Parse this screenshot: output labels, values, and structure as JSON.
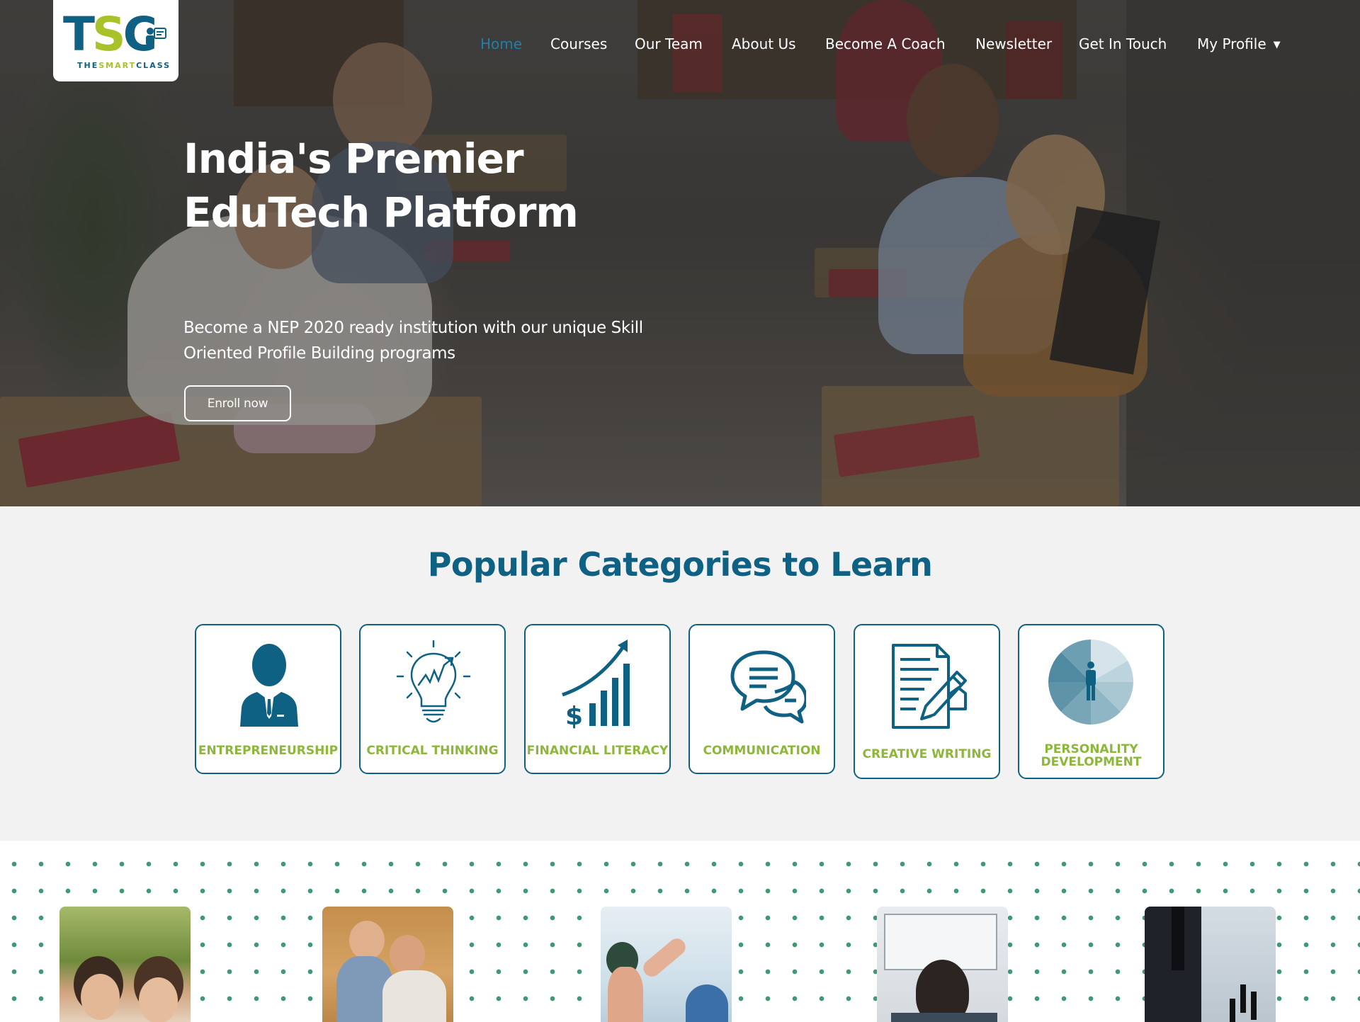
{
  "logo": {
    "letters": [
      "T",
      "S",
      "C"
    ],
    "tagline_parts": [
      "THE",
      "SMART",
      "CLASS"
    ]
  },
  "nav": {
    "items": [
      {
        "label": "Home",
        "active": true
      },
      {
        "label": "Courses"
      },
      {
        "label": "Our Team"
      },
      {
        "label": "About Us"
      },
      {
        "label": "Become A Coach"
      },
      {
        "label": "Newsletter"
      },
      {
        "label": "Get In Touch"
      },
      {
        "label": "My Profile",
        "has_dropdown": true,
        "dropdown_icon": "chevron-down-icon"
      }
    ]
  },
  "hero": {
    "title_line1": "India's Premier",
    "title_line2": "EduTech Platform",
    "subtitle_line1": "Become a NEP 2020 ready institution with our unique Skill",
    "subtitle_line2": "Oriented Profile Building programs",
    "cta_label": "Enroll now"
  },
  "categories": {
    "title": "Popular Categories to Learn",
    "items": [
      {
        "label": "ENTREPRENEURSHIP",
        "icon": "businessman-icon"
      },
      {
        "label": "CRITICAL THINKING",
        "icon": "lightbulb-icon"
      },
      {
        "label": "FINANCIAL LITERACY",
        "icon": "growth-chart-icon"
      },
      {
        "label": "COMMUNICATION",
        "icon": "chat-bubbles-icon"
      },
      {
        "label": "CREATIVE WRITING",
        "icon": "document-pen-icon"
      },
      {
        "label": "PERSONALITY DEVELOPMENT",
        "icon": "personality-wheel-icon"
      }
    ]
  },
  "colors": {
    "brand_blue": "#0f6183",
    "brand_green": "#a8c22a",
    "label_green": "#8db73a",
    "active_nav": "#1f7fa9",
    "dots": "#3f9a74"
  }
}
